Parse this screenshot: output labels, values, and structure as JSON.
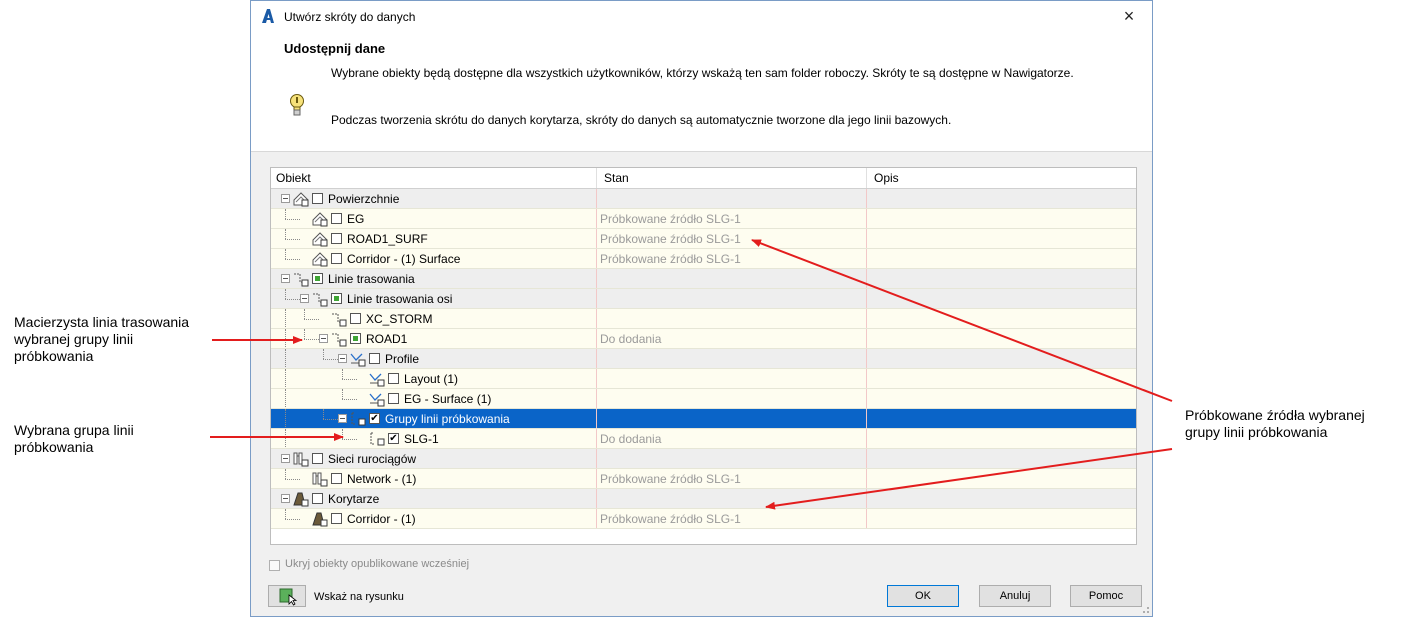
{
  "annotations": {
    "left_top": [
      "Macierzysta linia trasowania",
      "wybranej grupy linii",
      "próbkowania"
    ],
    "left_bottom": [
      "Wybrana grupa linii",
      "próbkowania"
    ],
    "right": [
      "Próbkowane źródła wybranej",
      "grupy linii próbkowania"
    ]
  },
  "dialog": {
    "title": "Utwórz skróty do danych",
    "close_glyph": "×",
    "heading": "Udostępnij dane",
    "para1": "Wybrane obiekty będą dostępne dla wszystkich użytkowników, którzy wskażą ten sam folder roboczy. Skróty te są dostępne w Nawigatorze.",
    "para2": "Podczas tworzenia skrótu do danych korytarza, skróty do danych są automatycznie tworzone dla jego linii bazowych.",
    "hide_label": "Ukryj obiekty opublikowane wcześniej",
    "pick_label": "Wskaż na rysunku",
    "ok": "OK",
    "cancel": "Anuluj",
    "help": "Pomoc"
  },
  "columns": {
    "object": "Obiekt",
    "status": "Stan",
    "description": "Opis"
  },
  "rows": [
    {
      "label": "Powierzchnie",
      "status": "",
      "level": 0,
      "type": "group",
      "icon": "surface-icon",
      "check": "unchecked",
      "expander": true
    },
    {
      "label": "EG",
      "status": "Próbkowane źródło SLG-1",
      "level": 1,
      "type": "leaf",
      "icon": "surface-icon",
      "check": "unchecked",
      "expander": false
    },
    {
      "label": "ROAD1_SURF",
      "status": "Próbkowane źródło SLG-1",
      "level": 1,
      "type": "leaf",
      "icon": "surface-icon",
      "check": "unchecked",
      "expander": false
    },
    {
      "label": "Corridor - (1) Surface",
      "status": "Próbkowane źródło SLG-1",
      "level": 1,
      "type": "leaf",
      "icon": "surface-icon",
      "check": "unchecked",
      "expander": false
    },
    {
      "label": "Linie trasowania",
      "status": "",
      "level": 0,
      "type": "group",
      "icon": "alignment-icon",
      "check": "partial",
      "expander": true
    },
    {
      "label": "Linie trasowania osi",
      "status": "",
      "level": 1,
      "type": "group",
      "icon": "alignment-icon",
      "check": "partial",
      "expander": true
    },
    {
      "label": "XC_STORM",
      "status": "",
      "level": 2,
      "type": "leaf",
      "icon": "alignment-icon",
      "check": "unchecked",
      "expander": false
    },
    {
      "label": "ROAD1",
      "status": "Do dodania",
      "level": 2,
      "type": "leaf",
      "icon": "alignment-icon",
      "check": "partial",
      "expander": true
    },
    {
      "label": "Profile",
      "status": "",
      "level": 3,
      "type": "group",
      "icon": "profile-icon",
      "check": "unchecked",
      "expander": true
    },
    {
      "label": "Layout (1)",
      "status": "",
      "level": 4,
      "type": "leaf",
      "icon": "profile-icon",
      "check": "unchecked",
      "expander": false
    },
    {
      "label": "EG - Surface (1)",
      "status": "",
      "level": 4,
      "type": "leaf",
      "icon": "profile-icon",
      "check": "unchecked",
      "expander": false
    },
    {
      "label": "Grupy linii próbkowania",
      "status": "",
      "level": 3,
      "type": "selected",
      "icon": "sample-line-icon",
      "check": "checked",
      "expander": true
    },
    {
      "label": "SLG-1",
      "status": "Do dodania",
      "level": 4,
      "type": "leaf",
      "icon": "sample-line-icon",
      "check": "checked",
      "expander": false
    },
    {
      "label": "Sieci rurociągów",
      "status": "",
      "level": 0,
      "type": "group",
      "icon": "pipe-network-icon",
      "check": "unchecked",
      "expander": true
    },
    {
      "label": "Network - (1)",
      "status": "Próbkowane źródło SLG-1",
      "level": 1,
      "type": "leaf",
      "icon": "pipe-network-icon",
      "check": "unchecked",
      "expander": false
    },
    {
      "label": "Korytarze",
      "status": "",
      "level": 0,
      "type": "group",
      "icon": "corridor-icon",
      "check": "unchecked",
      "expander": true
    },
    {
      "label": "Corridor - (1)",
      "status": "Próbkowane źródło SLG-1",
      "level": 1,
      "type": "leaf",
      "icon": "corridor-icon",
      "check": "unchecked",
      "expander": false
    }
  ],
  "colors": {
    "arrow": "#e31d1d",
    "selection": "#0a64c8",
    "leaf_bg": "#fefdf0",
    "group_bg": "#eeeeee"
  }
}
